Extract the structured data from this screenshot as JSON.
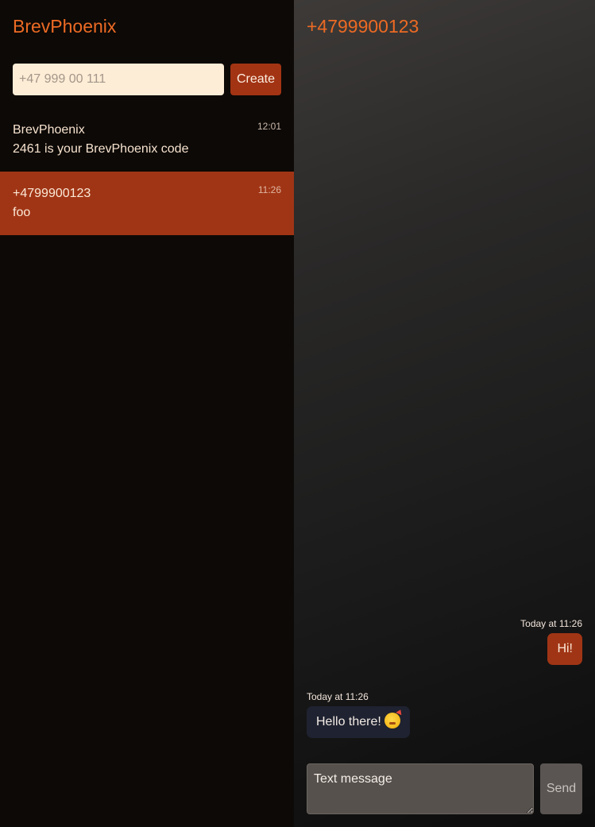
{
  "sidebar": {
    "brand": "BrevPhoenix",
    "new_conversation": {
      "placeholder": "+47 999 00 111",
      "value": "",
      "create_label": "Create"
    },
    "conversations": [
      {
        "name": "BrevPhoenix",
        "preview": "2461 is your BrevPhoenix code",
        "time": "12:01",
        "active": false
      },
      {
        "name": "+4799900123",
        "preview": "foo",
        "time": "11:26",
        "active": true
      }
    ]
  },
  "chat": {
    "title": "+4799900123",
    "messages": [
      {
        "direction": "outgoing",
        "meta": "Today at 11:26",
        "text": "Hi!"
      },
      {
        "direction": "incoming",
        "meta": "Today at 11:26",
        "text": "Hello there!",
        "emoji": "face-with-party-horn-icon"
      }
    ],
    "composer": {
      "placeholder": "Text message",
      "send_label": "Send"
    }
  },
  "colors": {
    "accent": "#ec6a24",
    "active_row": "#a03515",
    "input_bg": "#feedd6",
    "incoming_bubble": "#1f2230"
  }
}
